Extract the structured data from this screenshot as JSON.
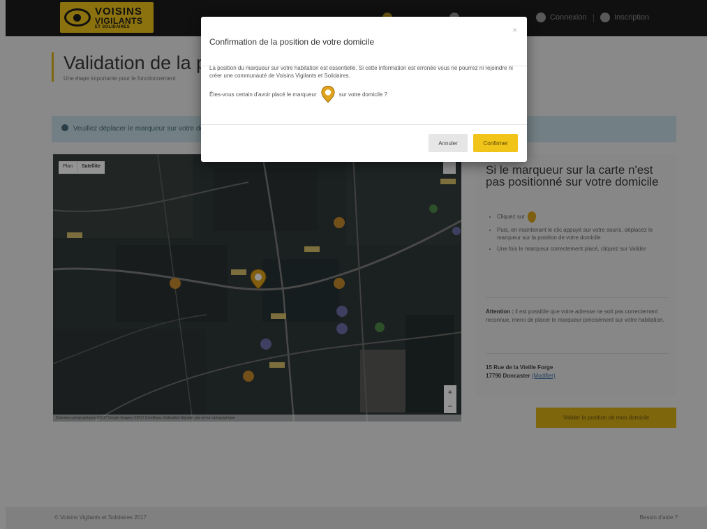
{
  "header": {
    "logo": {
      "line1": "VOISINS",
      "line2": "VIGILANTS",
      "line3": "ET SOLIDAIRES"
    },
    "nav": [
      {
        "label": "",
        "icon": "user-icon"
      },
      {
        "label": "",
        "icon": "bell-icon"
      },
      {
        "label": "Connexion",
        "icon": "login-icon"
      },
      {
        "label": "Inscription",
        "icon": "register-icon"
      }
    ]
  },
  "page": {
    "title": "Validation de la po",
    "subtitle": "Une étape importante pour le fonctionnement"
  },
  "alert": {
    "text": "Veuillez déplacer le marqueur sur votre domicile"
  },
  "map": {
    "toggle": [
      "Plan",
      "Satellite"
    ],
    "zoom_in": "+",
    "zoom_out": "−",
    "attribution": "Données cartographiques ©2017 Google Imagery ©2017 Conditions d'utilisation Signaler une erreur cartographique"
  },
  "side": {
    "title": "Si le marqueur sur la carte n'est pas positionné sur votre domicile",
    "steps": [
      "Cliquez sur",
      "Puis, en maintenant le clic appuyé sur votre souris, déplacez le marqueur sur la position de votre domicile",
      "Une fois le marqueur correctement placé, cliquez sur Valider"
    ],
    "note_label": "Attention :",
    "note_text": "il est possible que votre adresse ne soit pas correctement reconnue, merci de placer le marqueur précisément sur votre habitation.",
    "address_line1": "15 Rue de la Vieille Forge",
    "address_line2": "17790 Doncaster",
    "address_link": "(Modifier)",
    "validate_button": "Valider la position de mon domicile"
  },
  "footer": {
    "left": "© Voisins Vigilants et Solidaires 2017",
    "right": "Besoin d'aide ?"
  },
  "modal": {
    "title": "Confirmation de la position de votre domicile",
    "close": "×",
    "body": "La position du marqueur sur votre habitation est essentielle. Si cette information est erronée vous ne pourrez ni rejoindre ni créer une communauté de Voisins Vigilants et Solidaires.",
    "question_before": "Êtes-vous certain d'avoir placé le marqueur",
    "question_after": "sur votre domicile ?",
    "cancel": "Annuler",
    "confirm": "Confirmer"
  },
  "colors": {
    "accent": "#f0c419",
    "header_bg": "#1c1c1c",
    "alert_bg": "#c5dce6"
  }
}
